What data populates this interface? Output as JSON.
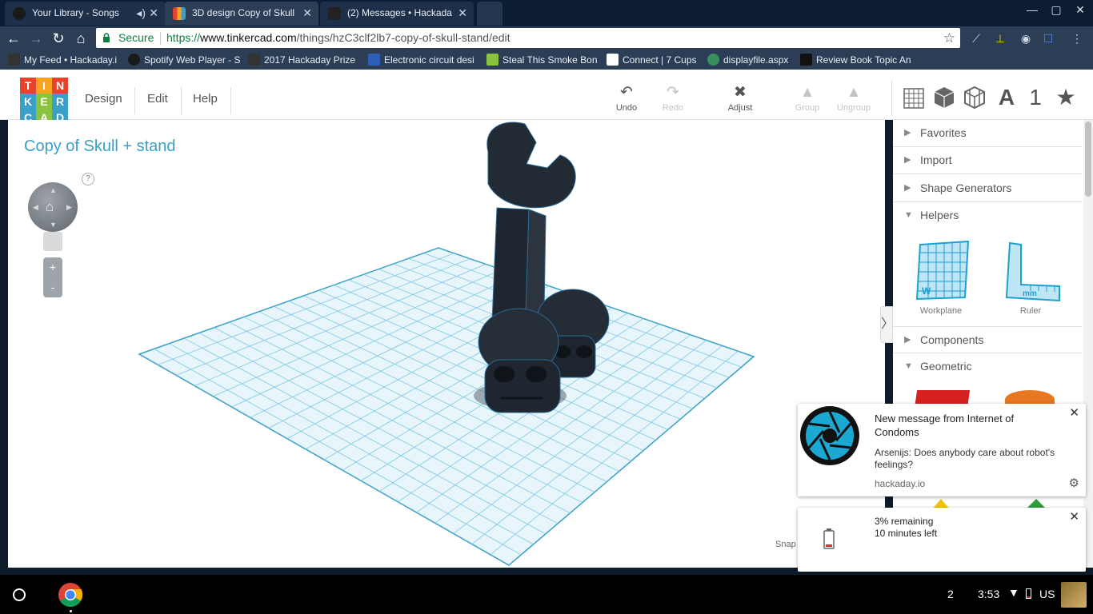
{
  "browser": {
    "tabs": [
      {
        "title": "Your Library - Songs",
        "active": false
      },
      {
        "title": "3D design Copy of Skull",
        "active": true
      },
      {
        "title": "(2) Messages • Hackada",
        "active": false
      }
    ],
    "secure_label": "Secure",
    "url_scheme": "https://",
    "url_host": "www.tinkercad.com",
    "url_path": "/things/hzC3clf2lb7-copy-of-skull-stand/edit",
    "bookmarks": [
      "My Feed • Hackaday.i",
      "Spotify Web Player - S",
      "2017 Hackaday Prize",
      "Electronic circuit desi",
      "Steal This Smoke Bon",
      "Connect | 7 Cups",
      "displayfile.aspx",
      "Review Book Topic An"
    ]
  },
  "tinkercad": {
    "logo_letters": [
      "T",
      "I",
      "N",
      "K",
      "E",
      "R",
      "C",
      "A",
      "D"
    ],
    "logo_colors": [
      "#e8412c",
      "#f7a520",
      "#e8412c",
      "#3aa0c8",
      "#8ac43f",
      "#3aa0c8",
      "#3aa0c8",
      "#8ac43f",
      "#3aa0c8"
    ],
    "menu": [
      "Design",
      "Edit",
      "Help"
    ],
    "tools": {
      "undo": "Undo",
      "redo": "Redo",
      "adjust": "Adjust",
      "group": "Group",
      "ungroup": "Ungroup"
    },
    "design_title": "Copy of Skull + stand",
    "help_glyph": "?",
    "zoom_in": "+",
    "zoom_out": "-",
    "snap_label": "Snap",
    "right_tools_text": {
      "text_tool": "A",
      "number_tool": "1"
    },
    "panel": {
      "sections": [
        "Favorites",
        "Import",
        "Shape Generators",
        "Helpers",
        "Components",
        "Geometric"
      ],
      "helpers": [
        {
          "label": "Workplane",
          "badge": "W"
        },
        {
          "label": "Ruler",
          "badge": "mm"
        }
      ]
    },
    "accent_color": "#3aa0c8"
  },
  "notifications": {
    "message": {
      "title": "New message from Internet of Condoms",
      "body": "Arsenijs: Does anybody care about robot's feelings?",
      "source": "hackaday.io"
    },
    "battery": {
      "line1": "3% remaining",
      "line2": "10 minutes left"
    }
  },
  "shelf": {
    "notification_count": "2",
    "time": "3:53",
    "input_method": "US"
  }
}
